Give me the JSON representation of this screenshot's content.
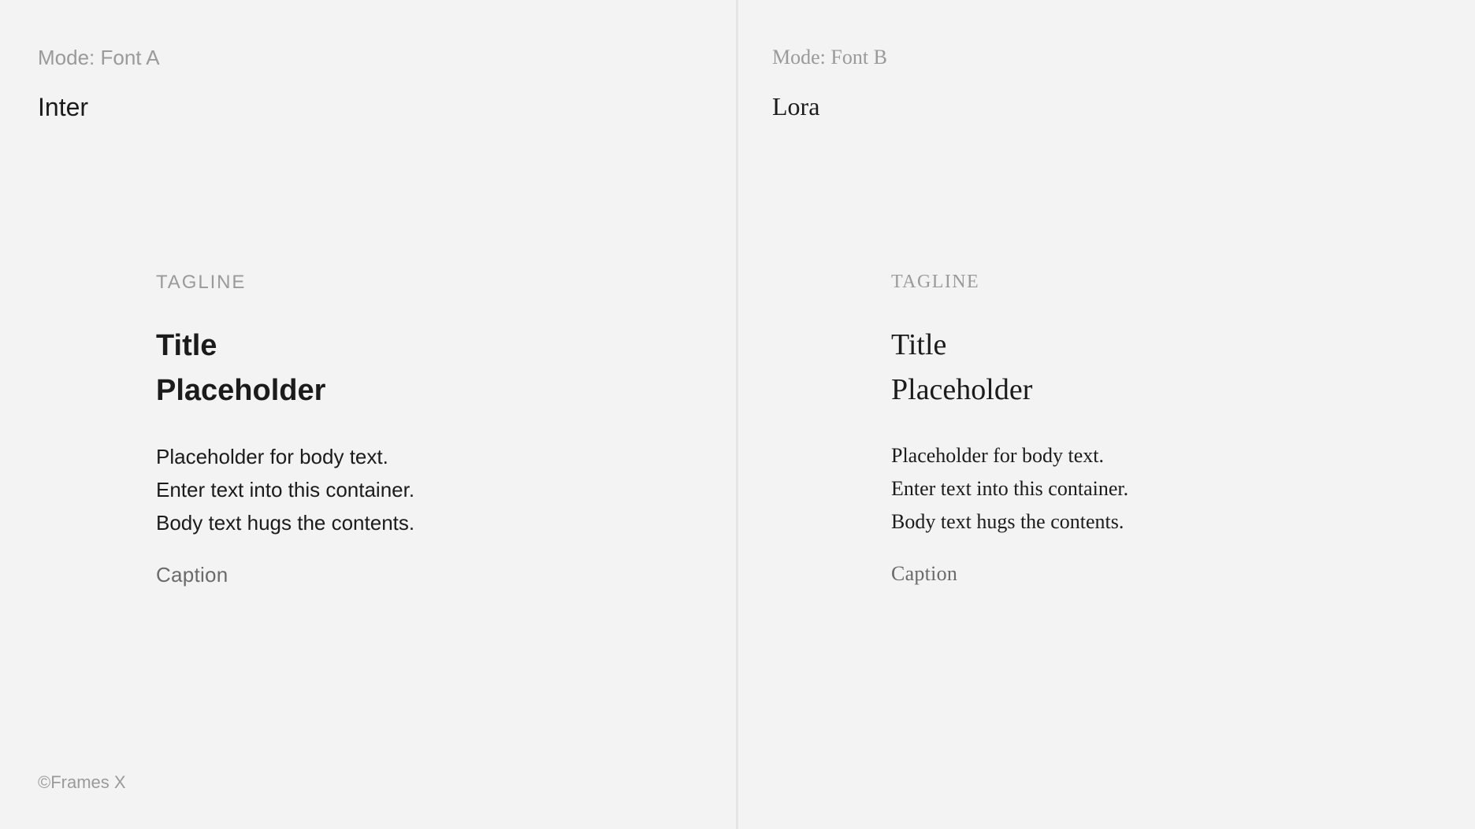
{
  "credit": "©Frames X",
  "left": {
    "mode_label": "Mode: Font A",
    "font_name": "Inter",
    "tagline": "TAGLINE",
    "title_line1": "Title",
    "title_line2": "Placeholder",
    "body_line1": "Placeholder for body text.",
    "body_line2": "Enter text into this container.",
    "body_line3": "Body text hugs the contents.",
    "caption": "Caption"
  },
  "right": {
    "mode_label": "Mode: Font B",
    "font_name": "Lora",
    "tagline": "TAGLINE",
    "title_line1": "Title",
    "title_line2": "Placeholder",
    "body_line1": "Placeholder for body text.",
    "body_line2": "Enter text into this container.",
    "body_line3": "Body text hugs the contents.",
    "caption": "Caption"
  }
}
